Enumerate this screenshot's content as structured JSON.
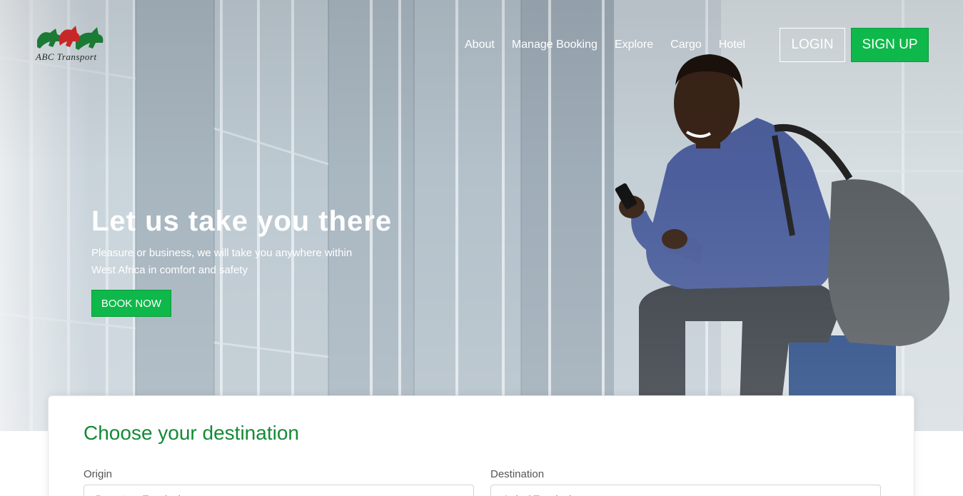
{
  "brand": {
    "logo_text": "ABC Transport"
  },
  "nav": {
    "items": [
      {
        "label": "About"
      },
      {
        "label": "Manage Booking"
      },
      {
        "label": "Explore"
      },
      {
        "label": "Cargo"
      },
      {
        "label": "Hotel"
      }
    ],
    "login_label": "LOGIN",
    "signup_label": "SIGN UP"
  },
  "hero": {
    "title": "Let us take you there",
    "subtitle": "Pleasure or business, we will take you anywhere within West Africa in comfort and safety",
    "cta_label": "BOOK NOW"
  },
  "booking": {
    "title": "Choose your destination",
    "origin_label": "Origin",
    "origin_placeholder": "Departure Terminal",
    "destination_label": "Destination",
    "destination_placeholder": "Arrival Terminal"
  },
  "colors": {
    "accent_green": "#0fb84a",
    "heading_green": "#138a36",
    "nav_text": "#ffffff"
  },
  "icons": [
    "horses-logo-icon"
  ]
}
